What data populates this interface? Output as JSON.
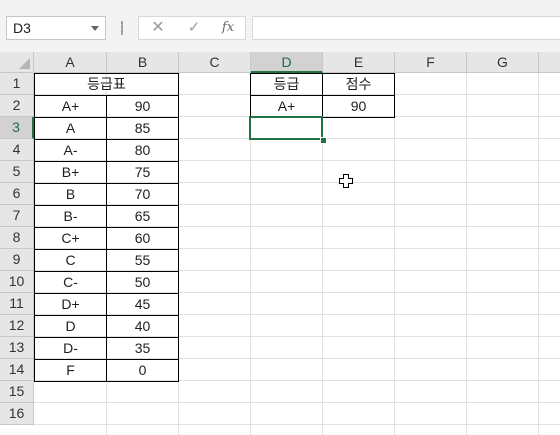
{
  "name_box": {
    "value": "D3"
  },
  "formula_bar": {
    "cancel_glyph": "✕",
    "enter_glyph": "✓",
    "fx_label": "fx",
    "value": ""
  },
  "columns": [
    "A",
    "B",
    "C",
    "D",
    "E",
    "F",
    "G"
  ],
  "rows": [
    "1",
    "2",
    "3",
    "4",
    "5",
    "6",
    "7",
    "8",
    "9",
    "10",
    "11",
    "12",
    "13",
    "14",
    "15",
    "16"
  ],
  "active_cell": {
    "column": "D",
    "row": "3"
  },
  "grade_table": {
    "title": "등급표",
    "grades": [
      "A+",
      "A",
      "A-",
      "B+",
      "B",
      "B-",
      "C+",
      "C",
      "C-",
      "D+",
      "D",
      "D-",
      "F"
    ],
    "scores": [
      "90",
      "85",
      "80",
      "75",
      "70",
      "65",
      "60",
      "55",
      "50",
      "45",
      "40",
      "35",
      "0"
    ]
  },
  "lookup_table": {
    "header_grade": "등급",
    "header_score": "점수",
    "grade_value": "A+",
    "score_value": "90"
  },
  "icons": {
    "cursor": "cell-select-cross-cursor"
  }
}
